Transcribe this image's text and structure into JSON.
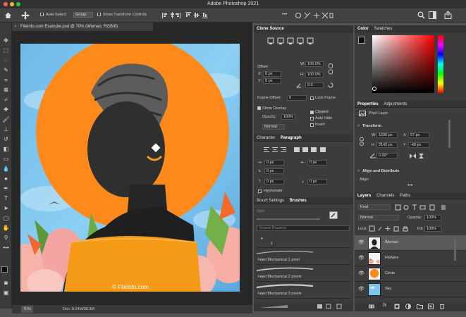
{
  "app": {
    "title": "Adobe Photoshop 2021"
  },
  "options": {
    "auto_select_label": "Auto-Select:",
    "auto_select_value": "Group",
    "show_transform_label": "Show Transform Controls",
    "dots": "•••",
    "mode_label": "3D Mode:"
  },
  "document": {
    "tab_title": "FileInfo.com Example.psd @ 70% (Woman, RGB/8)",
    "close": "×",
    "watermark": "© FileInfo.com"
  },
  "status": {
    "zoom": "70%",
    "doc_info": "Doc: 8.24M/38.3M"
  },
  "clone_source": {
    "title": "Clone Source",
    "offset_label": "Offset:",
    "w_label": "W:",
    "w_value": "100.0%",
    "h_label": "H:",
    "h_value": "100.0%",
    "x_label": "X:",
    "x_value": "0 px",
    "y_label": "Y:",
    "y_value": "0 px",
    "angle_value": "0.0",
    "frame_offset_label": "Frame Offset:",
    "frame_offset_value": "0",
    "lock_frame_label": "Lock Frame",
    "show_overlay_label": "Show Overlay",
    "clipped_label": "Clipped",
    "opacity_label": "Opacity:",
    "opacity_value": "100%",
    "auto_hide_label": "Auto Hide",
    "mode_value": "Normal",
    "invert_label": "Invert"
  },
  "paragraph": {
    "tab_character": "Character",
    "tab_paragraph": "Paragraph",
    "indent_left": "0 px",
    "indent_right": "0 px",
    "first_line": "0 px",
    "space_before": "0 px",
    "space_after": "0 px",
    "hyphenate_label": "Hyphenate"
  },
  "brushes": {
    "tab_settings": "Brush Settings",
    "tab_brushes": "Brushes",
    "size_label": "Size:",
    "search_placeholder": "Search Brushes",
    "preset_size": "1",
    "items": [
      "Hard Mechanical 1 pixel",
      "Hard Mechanical 2 pixels",
      "Hard Mechanical 3 pixels"
    ]
  },
  "color": {
    "tab_color": "Color",
    "tab_swatches": "Swatches"
  },
  "properties": {
    "tab_properties": "Properties",
    "tab_adjustments": "Adjustments",
    "pixel_layer_label": "Pixel Layer",
    "transform_label": "Transform",
    "w_label": "W",
    "w_value": "1206 px",
    "x_label": "X",
    "x_value": "57 px",
    "h_label": "H",
    "h_value": "2142 px",
    "y_label": "Y",
    "y_value": "-40 px",
    "angle_value": "0.00°",
    "align_label": "Align and Distribute",
    "align_sub": "Align:",
    "dots": "•••"
  },
  "layers": {
    "tab_layers": "Layers",
    "tab_channels": "Channels",
    "tab_paths": "Paths",
    "kind_value": "Kind",
    "blend_value": "Normal",
    "opacity_label": "Opacity:",
    "opacity_value": "100%",
    "lock_label": "Lock:",
    "fill_label": "Fill:",
    "fill_value": "100%",
    "items": [
      "Woman",
      "Flowers",
      "Circle",
      "Sky"
    ],
    "footer": "fx"
  }
}
